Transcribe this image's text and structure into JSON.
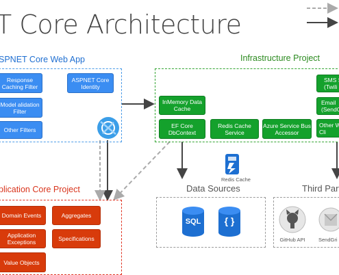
{
  "title": "T Core Architecture",
  "legend": {},
  "web_app": {
    "label": "SPNET Core Web App",
    "items": [
      "Response Caching Filter",
      "ASPNET Core Identity",
      "Model alidation Filter",
      "Other Filters"
    ]
  },
  "infrastructure": {
    "label": "Infrastructure Project",
    "items": [
      "InMemory Data Cache",
      "EF Core DbContext",
      "Redis Cache Service",
      "Azure Service Bus Accessor",
      "SMS S (Twili",
      "Email (SendG",
      "Other W Cli"
    ]
  },
  "app_core": {
    "label": "plication Core Project",
    "items": [
      "Domain Events",
      "Aggregates",
      "Application Exceptions",
      "Specifications",
      "Value Objects"
    ]
  },
  "data_sources": {
    "label": "Data Sources",
    "redis_label": "Redis Cache",
    "sql_label": "SQL",
    "doc_label": "{ }"
  },
  "third_party": {
    "label": "Third Party",
    "github_label": "GitHub API",
    "sendgrid_label": "SendGri"
  },
  "colors": {
    "blue": "#3b8df2",
    "green": "#14a12c",
    "red": "#d83b0b",
    "blue_frame": "#4a9be8",
    "green_frame": "#33a532",
    "red_frame": "#e0301e",
    "gray_frame": "#9a9a9a"
  }
}
